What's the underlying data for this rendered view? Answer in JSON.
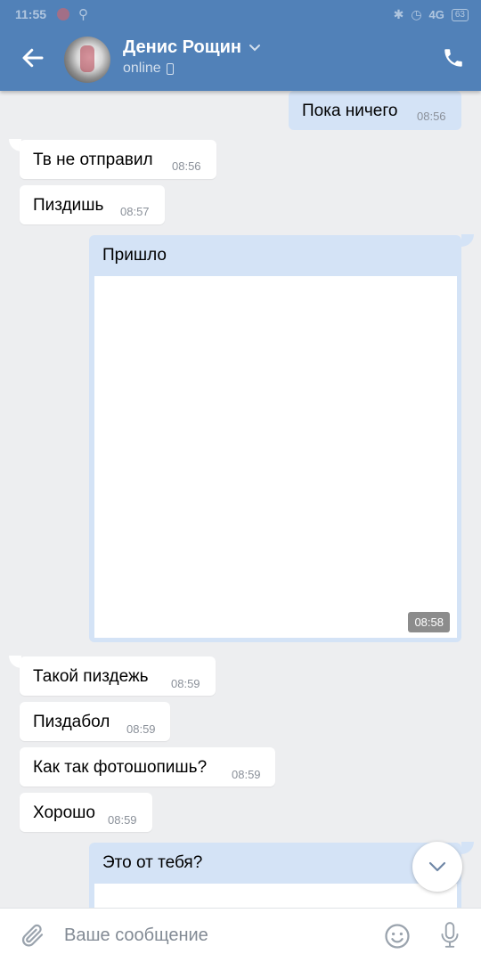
{
  "status_bar": {
    "time": "11:55",
    "network": "4G",
    "battery": "63"
  },
  "header": {
    "name": "Денис Рощин",
    "status": "online"
  },
  "messages": [
    {
      "text": "Пока ничего",
      "time": "08:56"
    },
    {
      "text": "Тв не отправил",
      "time": "08:56"
    },
    {
      "text": "Пиздишь",
      "time": "08:57"
    },
    {
      "text": "Пришло",
      "time": "08:58"
    },
    {
      "text": "Такой пиздежь",
      "time": "08:59"
    },
    {
      "text": "Пиздабол",
      "time": "08:59"
    },
    {
      "text": "Как так фотошопишь?",
      "time": "08:59"
    },
    {
      "text": "Хорошо",
      "time": "08:59"
    },
    {
      "text": "Это от тебя?"
    }
  ],
  "composer": {
    "placeholder": "Ваше сообщение"
  },
  "colors": {
    "header": "#5181b8",
    "background": "#edeef0",
    "outgoing_bubble": "#d4e3f6",
    "incoming_bubble": "#ffffff"
  },
  "icons": [
    "back-arrow-icon",
    "chevron-down-icon",
    "phone-call-icon",
    "mobile-device-icon",
    "chevron-down-icon",
    "paperclip-icon",
    "smile-icon",
    "microphone-icon"
  ]
}
